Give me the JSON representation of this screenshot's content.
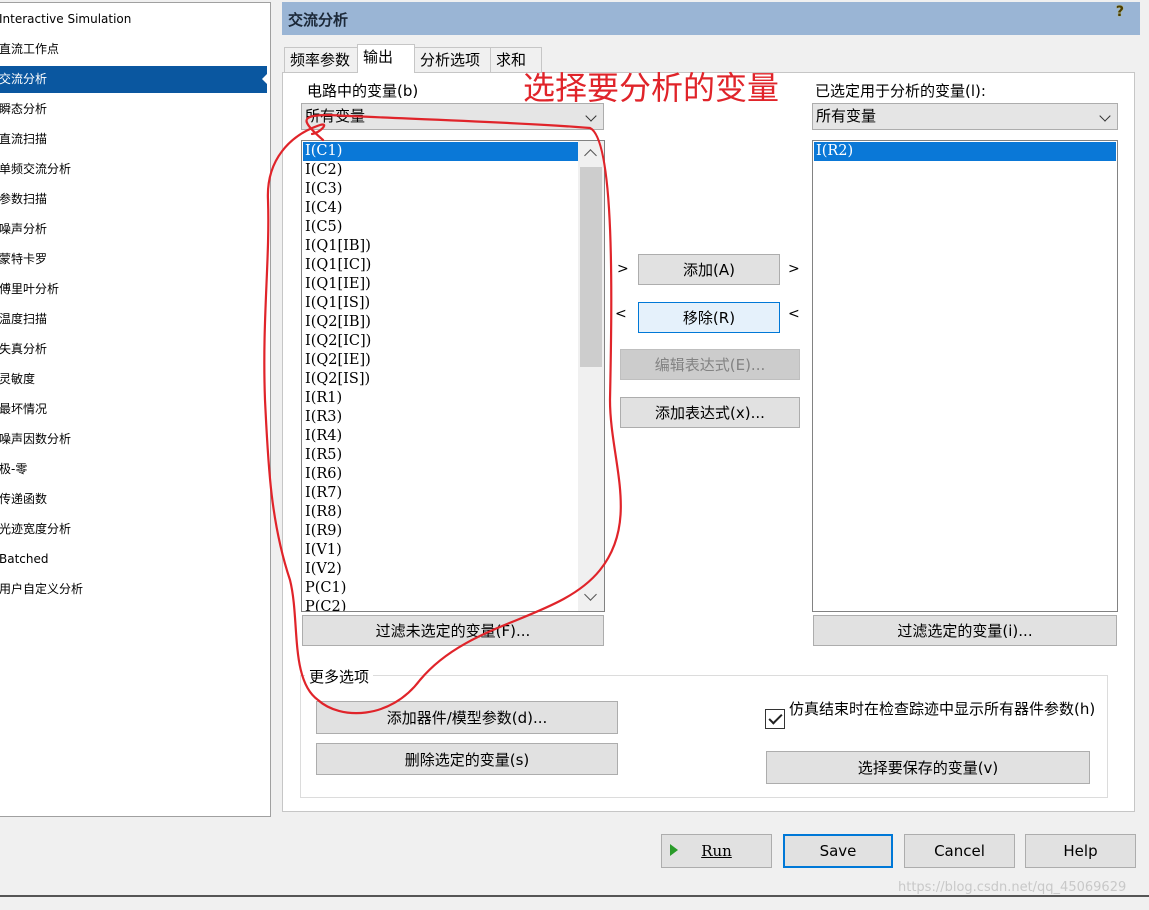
{
  "sidebar": {
    "items": [
      {
        "label": "Interactive Simulation"
      },
      {
        "label": "直流工作点"
      },
      {
        "label": "交流分析"
      },
      {
        "label": "瞬态分析"
      },
      {
        "label": "直流扫描"
      },
      {
        "label": "单频交流分析"
      },
      {
        "label": "参数扫描"
      },
      {
        "label": "噪声分析"
      },
      {
        "label": "蒙特卡罗"
      },
      {
        "label": "傅里叶分析"
      },
      {
        "label": "温度扫描"
      },
      {
        "label": "失真分析"
      },
      {
        "label": "灵敏度"
      },
      {
        "label": "最坏情况"
      },
      {
        "label": "噪声因数分析"
      },
      {
        "label": "极-零"
      },
      {
        "label": "传递函数"
      },
      {
        "label": "光迹宽度分析"
      },
      {
        "label": "Batched"
      },
      {
        "label": "用户自定义分析"
      }
    ],
    "selected": "交流分析"
  },
  "header": {
    "title": "交流分析",
    "help_icon": "?"
  },
  "tabs": [
    {
      "label": "频率参数"
    },
    {
      "label": "输出"
    },
    {
      "label": "分析选项"
    },
    {
      "label": "求和"
    }
  ],
  "left_panel": {
    "label": "电路中的变量(b)",
    "filter_value": "所有变量",
    "variables": [
      "I(C1)",
      "I(C2)",
      "I(C3)",
      "I(C4)",
      "I(C5)",
      "I(Q1[IB])",
      "I(Q1[IC])",
      "I(Q1[IE])",
      "I(Q1[IS])",
      "I(Q2[IB])",
      "I(Q2[IC])",
      "I(Q2[IE])",
      "I(Q2[IS])",
      "I(R1)",
      "I(R3)",
      "I(R4)",
      "I(R5)",
      "I(R6)",
      "I(R7)",
      "I(R8)",
      "I(R9)",
      "I(V1)",
      "I(V2)",
      "P(C1)",
      "P(C2)"
    ],
    "selected_variable": "I(C1)",
    "filter_button": "过滤未选定的变量(F)..."
  },
  "right_panel": {
    "label": "已选定用于分析的变量(l):",
    "filter_value": "所有变量",
    "variables": [
      "I(R2)"
    ],
    "filter_button": "过滤选定的变量(i)..."
  },
  "middle": {
    "add_button": "添加(A)",
    "remove_button": "移除(R)",
    "edit_expr_button": "编辑表达式(E)...",
    "add_expr_button": "添加表达式(x)...",
    "arrow_right": ">",
    "arrow_left": "<"
  },
  "more_options": {
    "label": "更多选项",
    "add_device_button": "添加器件/模型参数(d)...",
    "delete_var_button": "删除选定的变量(s)",
    "checkbox_label": "仿真结束时在检查踪迹中显示所有器件参数(h)",
    "checkbox_checked": true,
    "save_vars_button": "选择要保存的变量(v)"
  },
  "footer": {
    "run_button": "Run",
    "save_button": "Save",
    "cancel_button": "Cancel",
    "help_button": "Help"
  },
  "annotation": {
    "text": "选择要分析的变量",
    "color": "#e0242a"
  },
  "watermark": "https://blog.csdn.net/qq_45069629",
  "colors": {
    "selection": "#0a57a0",
    "list_selection": "#0a78d7",
    "header_bg": "#9ab5d5"
  }
}
